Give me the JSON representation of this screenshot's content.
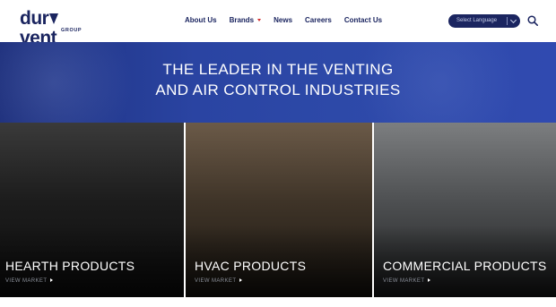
{
  "header": {
    "logo": {
      "text_left": "dur",
      "text_right": "vent",
      "sub": "GROUP"
    },
    "nav": [
      {
        "label": "About Us"
      },
      {
        "label": "Brands",
        "has_dropdown": true
      },
      {
        "label": "News"
      },
      {
        "label": "Careers"
      },
      {
        "label": "Contact Us"
      }
    ],
    "language_select": {
      "label": "Select Language"
    },
    "search_icon": "search-icon"
  },
  "hero": {
    "line1": "THE LEADER IN THE VENTING",
    "line2": "AND AIR CONTROL INDUSTRIES"
  },
  "panels": [
    {
      "title": "HEARTH PRODUCTS",
      "link": "VIEW MARKET"
    },
    {
      "title": "HVAC PRODUCTS",
      "link": "VIEW MARKET"
    },
    {
      "title": "COMMERCIAL PRODUCTS",
      "link": "VIEW MARKET"
    }
  ],
  "colors": {
    "brand_navy": "#1b2560",
    "hero_blue": "#2d49a8",
    "accent_red": "#d32f2f"
  }
}
